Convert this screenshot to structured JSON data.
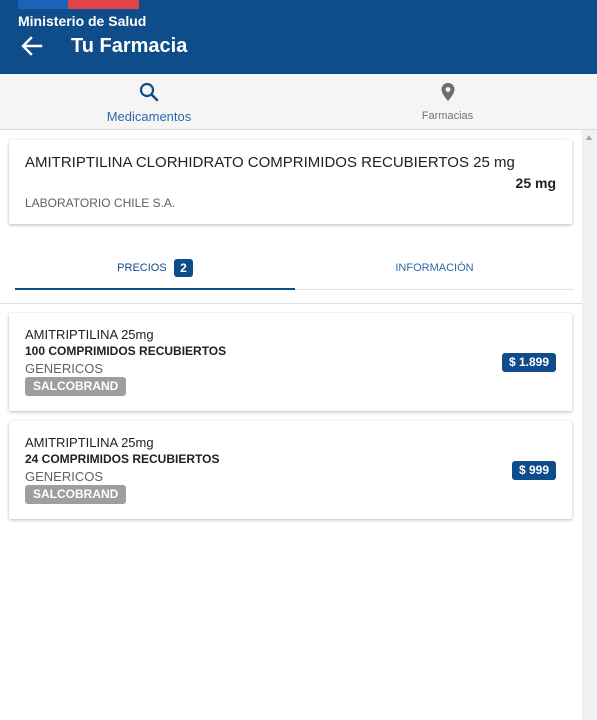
{
  "header": {
    "org": "Ministerio de Salud",
    "title": "Tu Farmacia",
    "colors": {
      "bar": "#0f4c8a",
      "flag_blue": "#1c62b8",
      "flag_red": "#e04448"
    }
  },
  "nav": {
    "tabs": [
      {
        "label": "Medicamentos",
        "icon": "search-icon",
        "active": true
      },
      {
        "label": "Farmacias",
        "icon": "location-pin-icon",
        "active": false
      }
    ]
  },
  "product": {
    "name": "AMITRIPTILINA CLORHIDRATO COMPRIMIDOS RECUBIERTOS 25 mg",
    "dose": "25 mg",
    "laboratory": "LABORATORIO CHILE S.A."
  },
  "tabs": {
    "prices_label": "PRECIOS",
    "prices_count": "2",
    "info_label": "INFORMACIÓN",
    "active": "PRECIOS"
  },
  "offers": [
    {
      "name": "AMITRIPTILINA 25mg",
      "quantity": "100 COMPRIMIDOS RECUBIERTOS",
      "brand": "GENERICOS",
      "store": "SALCOBRAND",
      "price": "$ 1.899"
    },
    {
      "name": "AMITRIPTILINA 25mg",
      "quantity": "24 COMPRIMIDOS RECUBIERTOS",
      "brand": "GENERICOS",
      "store": "SALCOBRAND",
      "price": "$ 999"
    }
  ]
}
